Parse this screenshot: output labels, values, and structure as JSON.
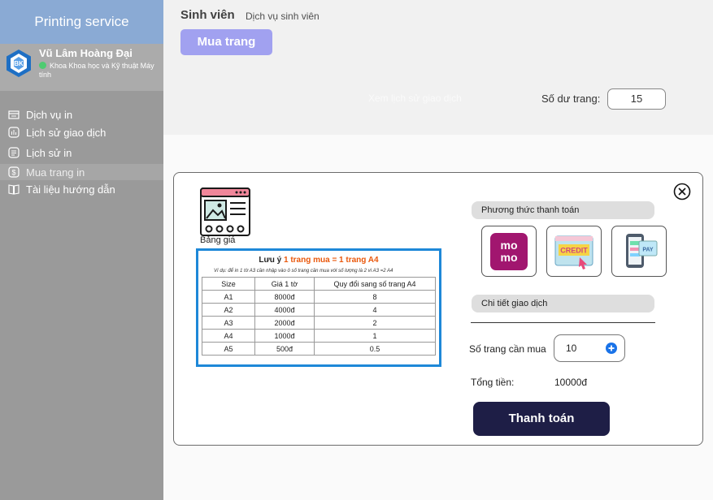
{
  "sidebar": {
    "brand": "Printing service",
    "logo_text": "BK",
    "user": {
      "name": "Vũ Lâm Hoàng Đại",
      "faculty": "Khoa Khoa học và Kỹ thuật Máy tính"
    },
    "items": [
      {
        "label": "Dịch vụ in",
        "icon": "printer-icon"
      },
      {
        "label": "Lịch sử giao dịch",
        "icon": "chart-icon"
      },
      {
        "label": "Lịch sử in",
        "icon": "document-icon"
      },
      {
        "label": "Mua trang in",
        "icon": "dollar-icon",
        "active": true
      },
      {
        "label": "Tài liệu hướng dẫn",
        "icon": "book-icon"
      }
    ]
  },
  "header": {
    "title": "Sinh viên",
    "subtitle": "Dịch vụ sinh viên",
    "buy_button": "Mua trang",
    "ghost_text": "Xem lịch sử giao dịch",
    "balance_label": "Số dư trang:",
    "balance_value": "15"
  },
  "modal": {
    "price_label": "Bảng giá",
    "note_prefix": "Lưu ý",
    "note_highlight": "1 trang mua = 1 trang A4",
    "note_example": "Ví dụ: để in 1 tờ A3 cần nhập vào ô số trang cần mua với số lượng là 2 vì A3 =2 A4",
    "table": {
      "headers": [
        "Size",
        "Giá 1 tờ",
        "Quy đổi sang số trang A4"
      ],
      "rows": [
        [
          "A1",
          "8000đ",
          "8"
        ],
        [
          "A2",
          "4000đ",
          "4"
        ],
        [
          "A3",
          "2000đ",
          "2"
        ],
        [
          "A4",
          "1000đ",
          "1"
        ],
        [
          "A5",
          "500đ",
          "0.5"
        ]
      ]
    },
    "payment_method_label": "Phương thức thanh toán",
    "payment_methods": [
      {
        "name": "momo",
        "text_top": "mo",
        "text_bottom": "mo"
      },
      {
        "name": "credit",
        "text": "CREDIT"
      },
      {
        "name": "pay",
        "text": "PAY"
      }
    ],
    "details_label": "Chi tiết giao dịch",
    "qty_label": "Số trang cần mua",
    "qty_value": "10",
    "total_label": "Tổng tiền:",
    "total_value": "10000đ",
    "pay_button": "Thanh toán"
  }
}
